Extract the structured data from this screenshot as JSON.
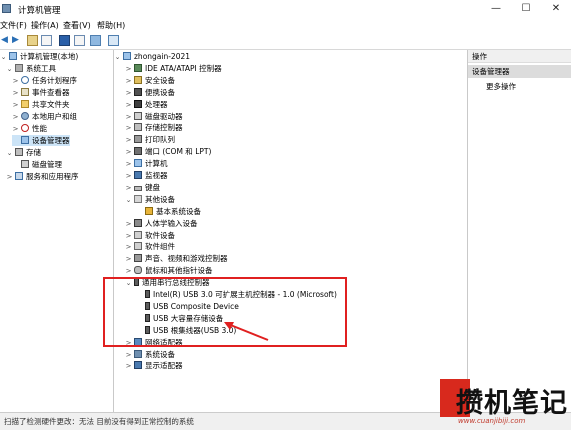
{
  "window": {
    "title": "计算机管理",
    "min": "—",
    "max": "☐",
    "close": "✕"
  },
  "menu": [
    "文件(F)",
    "操作(A)",
    "查看(V)",
    "帮助(H)"
  ],
  "left_tree": [
    {
      "label": "计算机管理(本地)",
      "indent": 0,
      "chevron": "⌄",
      "icon": "computer"
    },
    {
      "label": "系统工具",
      "indent": 1,
      "chevron": "⌄",
      "icon": "tools"
    },
    {
      "label": "任务计划程序",
      "indent": 2,
      "chevron": ">",
      "icon": "clock"
    },
    {
      "label": "事件查看器",
      "indent": 2,
      "chevron": ">",
      "icon": "log"
    },
    {
      "label": "共享文件夹",
      "indent": 2,
      "chevron": ">",
      "icon": "folder"
    },
    {
      "label": "本地用户和组",
      "indent": 2,
      "chevron": ">",
      "icon": "users"
    },
    {
      "label": "性能",
      "indent": 2,
      "chevron": ">",
      "icon": "perf"
    },
    {
      "label": "设备管理器",
      "indent": 2,
      "chevron": "",
      "icon": "devmgr",
      "selected": true
    },
    {
      "label": "存储",
      "indent": 1,
      "chevron": "⌄",
      "icon": "storage"
    },
    {
      "label": "磁盘管理",
      "indent": 2,
      "chevron": "",
      "icon": "disk"
    },
    {
      "label": "服务和应用程序",
      "indent": 1,
      "chevron": ">",
      "icon": "services"
    }
  ],
  "device_tree": [
    {
      "label": "zhongain-2021",
      "indent": 0,
      "chevron": "⌄",
      "icon": "computer"
    },
    {
      "label": "IDE ATA/ATAPI 控制器",
      "indent": 1,
      "chevron": ">",
      "icon": "ide"
    },
    {
      "label": "安全设备",
      "indent": 1,
      "chevron": ">",
      "icon": "security"
    },
    {
      "label": "便携设备",
      "indent": 1,
      "chevron": ">",
      "icon": "portable"
    },
    {
      "label": "处理器",
      "indent": 1,
      "chevron": ">",
      "icon": "cpu"
    },
    {
      "label": "磁盘驱动器",
      "indent": 1,
      "chevron": ">",
      "icon": "disk"
    },
    {
      "label": "存储控制器",
      "indent": 1,
      "chevron": ">",
      "icon": "storage"
    },
    {
      "label": "打印队列",
      "indent": 1,
      "chevron": ">",
      "icon": "printer"
    },
    {
      "label": "端口 (COM 和 LPT)",
      "indent": 1,
      "chevron": ">",
      "icon": "port"
    },
    {
      "label": "计算机",
      "indent": 1,
      "chevron": ">",
      "icon": "computer"
    },
    {
      "label": "监视器",
      "indent": 1,
      "chevron": ">",
      "icon": "monitor"
    },
    {
      "label": "键盘",
      "indent": 1,
      "chevron": ">",
      "icon": "keyboard"
    },
    {
      "label": "其他设备",
      "indent": 1,
      "chevron": "⌄",
      "icon": "other"
    },
    {
      "label": "基本系统设备",
      "indent": 2,
      "chevron": "",
      "icon": "warning"
    },
    {
      "label": "人体学输入设备",
      "indent": 1,
      "chevron": ">",
      "icon": "hid"
    },
    {
      "label": "软件设备",
      "indent": 1,
      "chevron": ">",
      "icon": "software"
    },
    {
      "label": "软件组件",
      "indent": 1,
      "chevron": ">",
      "icon": "component"
    },
    {
      "label": "声音、视频和游戏控制器",
      "indent": 1,
      "chevron": ">",
      "icon": "sound"
    },
    {
      "label": "鼠标和其他指针设备",
      "indent": 1,
      "chevron": ">",
      "icon": "mouse"
    },
    {
      "label": "通用串行总线控制器",
      "indent": 1,
      "chevron": "⌄",
      "icon": "usb"
    },
    {
      "label": "Intel(R) USB 3.0 可扩展主机控制器 - 1.0 (Microsoft)",
      "indent": 2,
      "chevron": "",
      "icon": "usb"
    },
    {
      "label": "USB Composite Device",
      "indent": 2,
      "chevron": "",
      "icon": "usb"
    },
    {
      "label": "USB 大容量存储设备",
      "indent": 2,
      "chevron": "",
      "icon": "usb"
    },
    {
      "label": "USB 根集线器(USB 3.0)",
      "indent": 2,
      "chevron": "",
      "icon": "usb"
    },
    {
      "label": "网络适配器",
      "indent": 1,
      "chevron": ">",
      "icon": "network"
    },
    {
      "label": "系统设备",
      "indent": 1,
      "chevron": ">",
      "icon": "system"
    },
    {
      "label": "显示适配器",
      "indent": 1,
      "chevron": ">",
      "icon": "display"
    }
  ],
  "ops": {
    "header": "操作",
    "selected": "设备管理器",
    "more": "更多操作"
  },
  "status": "扫描了检测硬件更改：无法 目前没有得到正常控制的系统",
  "watermark": {
    "text": "攒机笔记",
    "url": "www.cuanjibiji.com"
  },
  "colors": {
    "highlight": "#e02020",
    "selection": "#cce4f7",
    "watermark_red": "#d8291d"
  }
}
